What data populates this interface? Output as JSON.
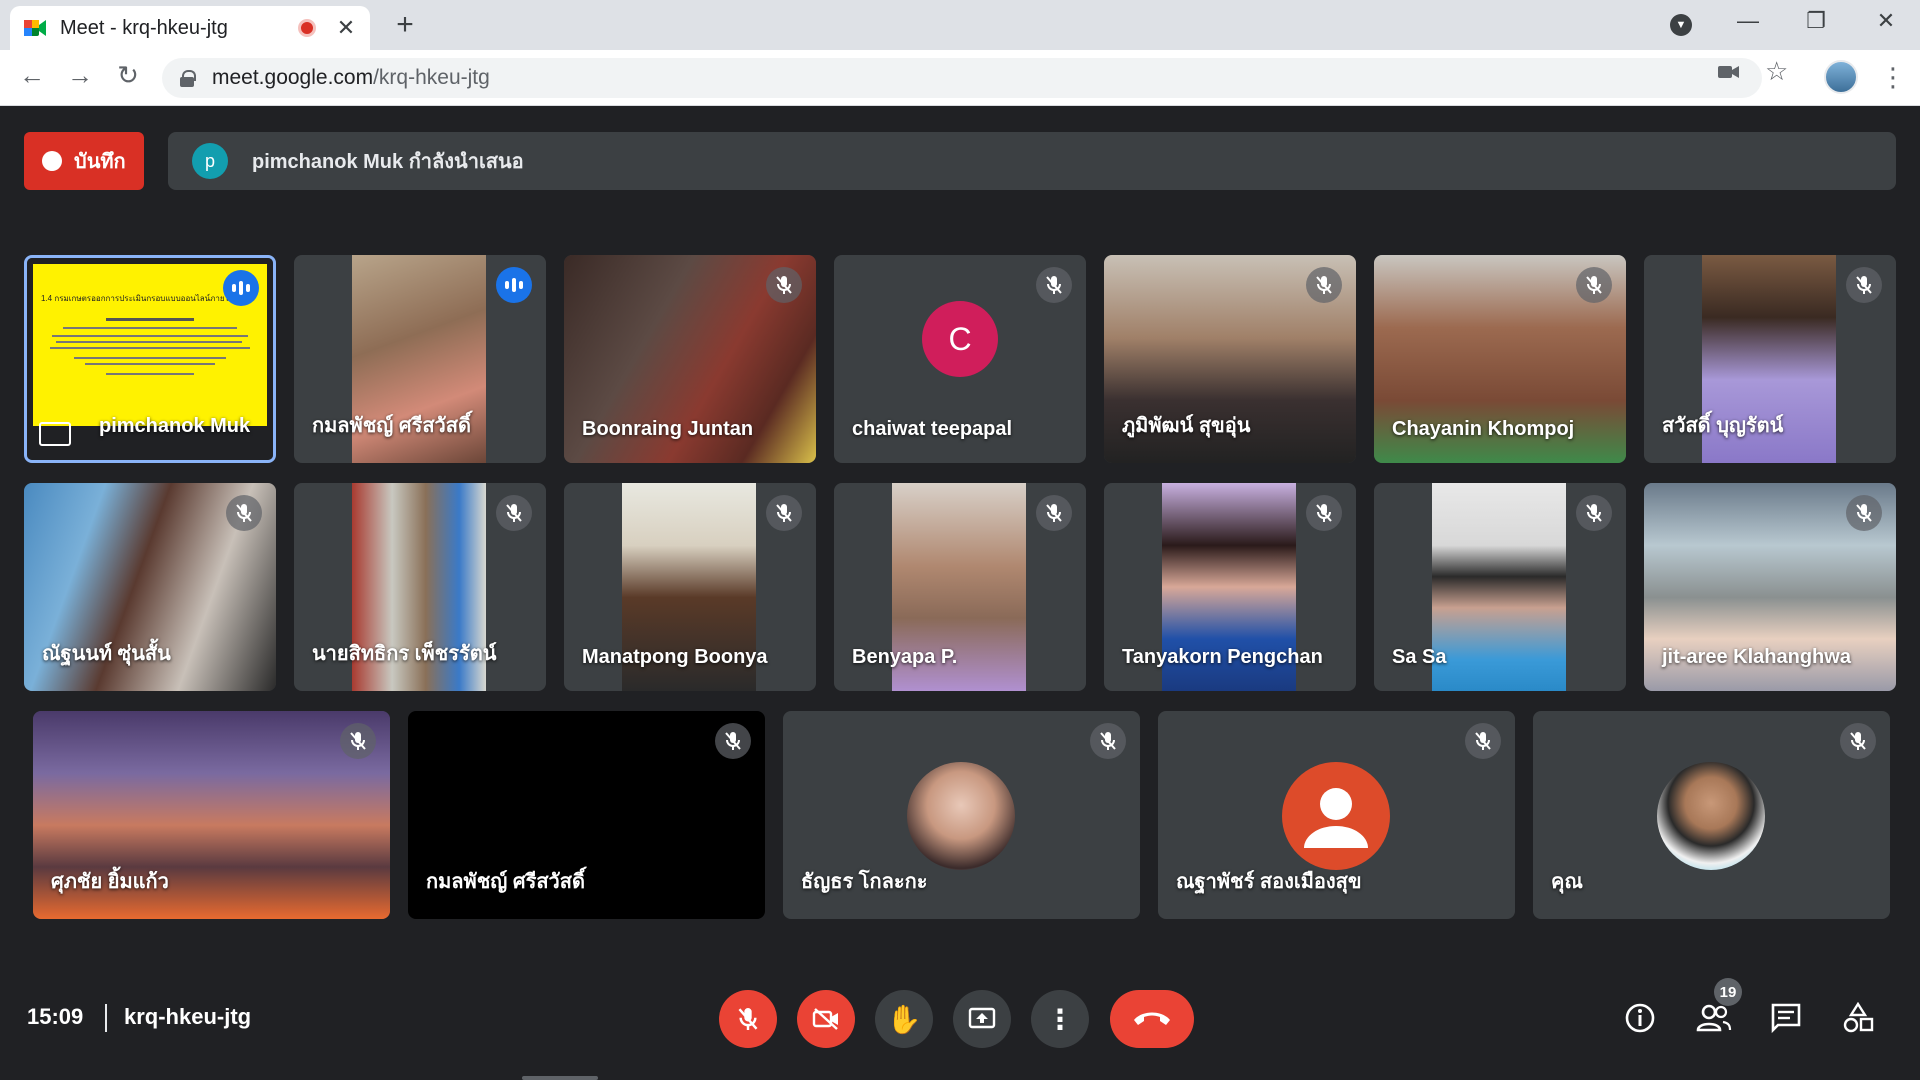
{
  "browser": {
    "tab_title": "Meet - krq-hkeu-jtg",
    "url_host": "meet.google.com",
    "url_path": "/krq-hkeu-jtg"
  },
  "meet": {
    "record_label": "บันทึก",
    "presenter_initial": "p",
    "presenting_text": "pimchanok Muk กำลังนำเสนอ",
    "clock": "15:09",
    "meeting_code": "krq-hkeu-jtg",
    "participant_count": "19"
  },
  "tiles_row1": [
    {
      "name": "pimchanok Muk",
      "mic": "speaking"
    },
    {
      "name": "กมลพัชญ์ ศรีสวัสดิ์",
      "mic": "speaking"
    },
    {
      "name": "Boonraing Juntan",
      "mic": "muted"
    },
    {
      "name": "chaiwat teepapal",
      "mic": "muted",
      "avatar_letter": "C"
    },
    {
      "name": "ภูมิพัฒน์ สุขอุ่น",
      "mic": "muted"
    },
    {
      "name": "Chayanin Khompoj",
      "mic": "muted"
    },
    {
      "name": "สวัสดิ์ บุญรัตน์",
      "mic": "muted"
    }
  ],
  "tiles_row2": [
    {
      "name": "ณัฐนนท์ ซุ่นสั้น",
      "mic": "muted"
    },
    {
      "name": "นายสิทธิกร เพ็ชรรัตน์",
      "mic": "muted"
    },
    {
      "name": "Manatpong Boonya",
      "mic": "muted"
    },
    {
      "name": "Benyapa P.",
      "mic": "muted"
    },
    {
      "name": "Tanyakorn Pengchan",
      "mic": "muted"
    },
    {
      "name": "Sa Sa",
      "mic": "muted"
    },
    {
      "name": "jit-aree Klahanghwa",
      "mic": "muted"
    }
  ],
  "tiles_row3": [
    {
      "name": "ศุภชัย ยิ้มแก้ว",
      "mic": "muted"
    },
    {
      "name": "กมลพัชญ์ ศรีสวัสดิ์",
      "mic": "muted"
    },
    {
      "name": "ธัญธร โกละกะ",
      "mic": "muted"
    },
    {
      "name": "ณฐาพัชร์ สองเมืองสุข",
      "mic": "muted"
    },
    {
      "name": "คุณ",
      "mic": "muted"
    }
  ],
  "slide": {
    "heading": "1.4 กรมเกษตรออกการประเมินกรอบแบบออนไลน์ภายใต้..."
  },
  "colors": {
    "meet_bg": "#202124",
    "tile_bg": "#3c4043",
    "red": "#ea4335",
    "speaking_blue": "#1a73e8"
  }
}
